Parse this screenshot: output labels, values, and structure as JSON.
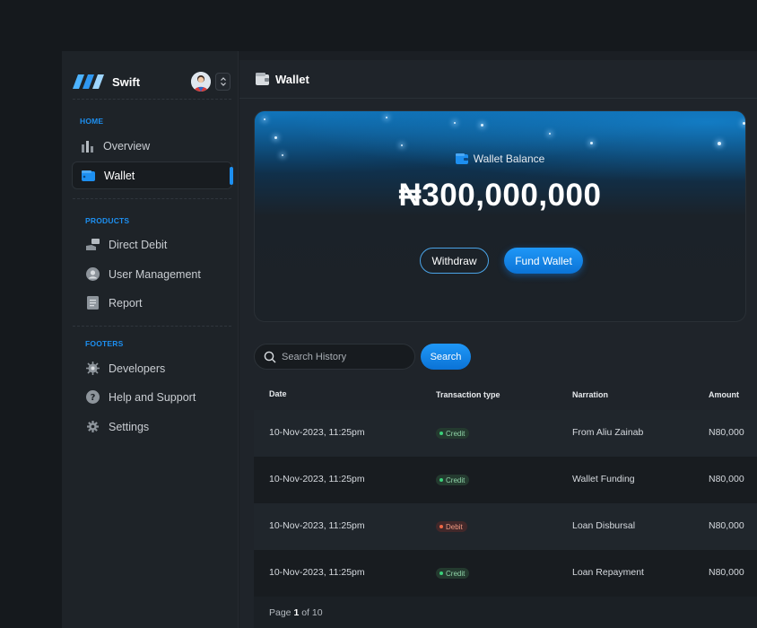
{
  "brand": {
    "name": "Swift"
  },
  "sidebar": {
    "sections": [
      {
        "label": "HOME"
      },
      {
        "label": "PRODUCTS"
      },
      {
        "label": "FOOTERS"
      }
    ],
    "items": [
      {
        "label": "Overview",
        "icon": "bar-chart-icon"
      },
      {
        "label": "Wallet",
        "icon": "wallet-icon",
        "active": true
      },
      {
        "label": "Direct Debit",
        "icon": "card-hand-icon"
      },
      {
        "label": "User Management",
        "icon": "user-icon"
      },
      {
        "label": "Report",
        "icon": "document-icon"
      },
      {
        "label": "Developers",
        "icon": "gear-chip-icon"
      },
      {
        "label": "Help and Support",
        "icon": "help-icon"
      },
      {
        "label": "Settings",
        "icon": "settings-icon"
      }
    ]
  },
  "header": {
    "title": "Wallet"
  },
  "balance": {
    "label": "Wallet Balance",
    "amount": "₦300,000,000",
    "withdraw_label": "Withdraw",
    "fund_label": "Fund Wallet"
  },
  "search": {
    "placeholder": "Search History",
    "button_label": "Search"
  },
  "table": {
    "columns": [
      "Date",
      "Transaction type",
      "Narration",
      "Amount"
    ],
    "rows": [
      {
        "date": "10-Nov-2023, 11:25pm",
        "type": "Credit",
        "narration": "From Aliu Zainab",
        "amount": "N80,000"
      },
      {
        "date": "10-Nov-2023, 11:25pm",
        "type": "Credit",
        "narration": "Wallet Funding",
        "amount": "N80,000"
      },
      {
        "date": "10-Nov-2023, 11:25pm",
        "type": "Debit",
        "narration": "Loan Disbursal",
        "amount": "N80,000"
      },
      {
        "date": "10-Nov-2023, 11:25pm",
        "type": "Credit",
        "narration": "Loan Repayment",
        "amount": "N80,000"
      }
    ],
    "pagination": {
      "prefix": "Page",
      "current": "1",
      "of": "of",
      "total": "10"
    }
  },
  "colors": {
    "accent": "#1d8ff0",
    "credit": "#3ad07a",
    "debit": "#f06845"
  }
}
